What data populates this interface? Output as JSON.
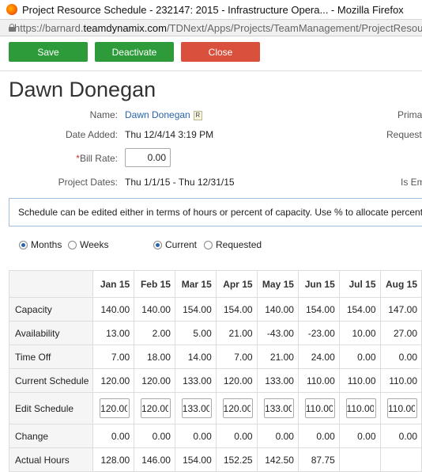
{
  "window": {
    "title": "Project Resource Schedule - 232147: 2015 - Infrastructure Opera... - Mozilla Firefox",
    "url_prefix": "https://barnard.",
    "url_domain": "teamdynamix.com",
    "url_path": "/TDNext/Apps/Projects/TeamManagement/ProjectResource"
  },
  "toolbar": {
    "save_label": "Save",
    "deactivate_label": "Deactivate",
    "close_label": "Close"
  },
  "resource": {
    "heading": "Dawn Donegan",
    "name_label": "Name:",
    "name_value": "Dawn Donegan",
    "badge": "R",
    "date_added_label": "Date Added:",
    "date_added_value": "Thu 12/4/14 3:19 PM",
    "bill_rate_required": "*",
    "bill_rate_label": "Bill Rate:",
    "bill_rate_value": "0.00",
    "project_dates_label": "Project Dates:",
    "project_dates_value": "Thu 1/1/15 - Thu 12/31/15",
    "right_label_1": "Prima",
    "right_label_2": "Requeste",
    "right_label_3": "Is Em"
  },
  "info": {
    "message": "Schedule can be edited either in terms of hours or percent of capacity. Use % to allocate percent o"
  },
  "view_options": {
    "months": "Months",
    "weeks": "Weeks",
    "current": "Current",
    "requested": "Requested",
    "months_selected": true,
    "current_selected": true
  },
  "schedule": {
    "columns": [
      "Jan 15",
      "Feb 15",
      "Mar 15",
      "Apr 15",
      "May 15",
      "Jun 15",
      "Jul 15",
      "Aug 15"
    ],
    "rows": [
      {
        "label": "Capacity",
        "values": [
          "140.00",
          "140.00",
          "154.00",
          "154.00",
          "140.00",
          "154.00",
          "154.00",
          "147.00"
        ]
      },
      {
        "label": "Availability",
        "values": [
          "13.00",
          "2.00",
          "5.00",
          "21.00",
          "-43.00",
          "-23.00",
          "10.00",
          "27.00"
        ]
      },
      {
        "label": "Time Off",
        "values": [
          "7.00",
          "18.00",
          "14.00",
          "7.00",
          "21.00",
          "24.00",
          "0.00",
          "0.00"
        ]
      },
      {
        "label": "Current Schedule",
        "values": [
          "120.00",
          "120.00",
          "133.00",
          "120.00",
          "133.00",
          "110.00",
          "110.00",
          "110.00"
        ]
      },
      {
        "label": "Edit Schedule",
        "values": [
          "120.00",
          "120.00",
          "133.00",
          "120.00",
          "133.00",
          "110.00",
          "110.00",
          "110.00"
        ]
      },
      {
        "label": "Change",
        "values": [
          "0.00",
          "0.00",
          "0.00",
          "0.00",
          "0.00",
          "0.00",
          "0.00",
          "0.00"
        ]
      },
      {
        "label": "Actual Hours",
        "values": [
          "128.00",
          "146.00",
          "154.00",
          "152.25",
          "142.50",
          "87.75",
          "",
          ""
        ]
      }
    ]
  }
}
